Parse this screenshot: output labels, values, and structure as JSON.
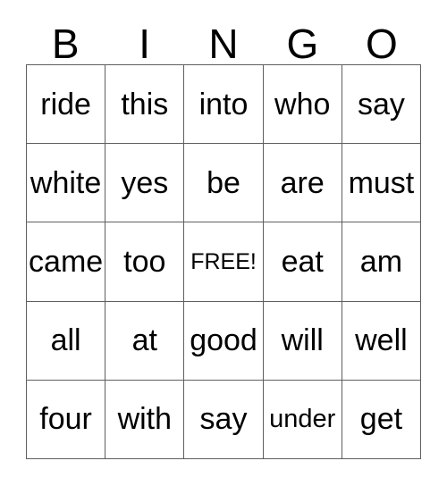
{
  "card": {
    "title": "BINGO",
    "header_letters": [
      "B",
      "I",
      "N",
      "G",
      "O"
    ],
    "free_space": {
      "row": 2,
      "column": 2,
      "label": "FREE!"
    },
    "grid_size": "5x5",
    "border_color": "#5f5f5f",
    "background_color": "#ffffff",
    "text_color": "#000000",
    "rows": [
      {
        "cells": [
          {
            "text": "ride",
            "size": "normal"
          },
          {
            "text": "this",
            "size": "normal"
          },
          {
            "text": "into",
            "size": "normal"
          },
          {
            "text": "who",
            "size": "normal"
          },
          {
            "text": "say",
            "size": "normal"
          }
        ]
      },
      {
        "cells": [
          {
            "text": "white",
            "size": "normal"
          },
          {
            "text": "yes",
            "size": "normal"
          },
          {
            "text": "be",
            "size": "normal"
          },
          {
            "text": "are",
            "size": "normal"
          },
          {
            "text": "must",
            "size": "normal"
          }
        ]
      },
      {
        "cells": [
          {
            "text": "came",
            "size": "normal"
          },
          {
            "text": "too",
            "size": "normal"
          },
          {
            "text": "FREE!",
            "size": "small"
          },
          {
            "text": "eat",
            "size": "normal"
          },
          {
            "text": "am",
            "size": "normal"
          }
        ]
      },
      {
        "cells": [
          {
            "text": "all",
            "size": "normal"
          },
          {
            "text": "at",
            "size": "normal"
          },
          {
            "text": "good",
            "size": "normal"
          },
          {
            "text": "will",
            "size": "normal"
          },
          {
            "text": "well",
            "size": "normal"
          }
        ]
      },
      {
        "cells": [
          {
            "text": "four",
            "size": "normal"
          },
          {
            "text": "with",
            "size": "normal"
          },
          {
            "text": "say",
            "size": "normal"
          },
          {
            "text": "under",
            "size": "medium"
          },
          {
            "text": "get",
            "size": "normal"
          }
        ]
      }
    ]
  }
}
